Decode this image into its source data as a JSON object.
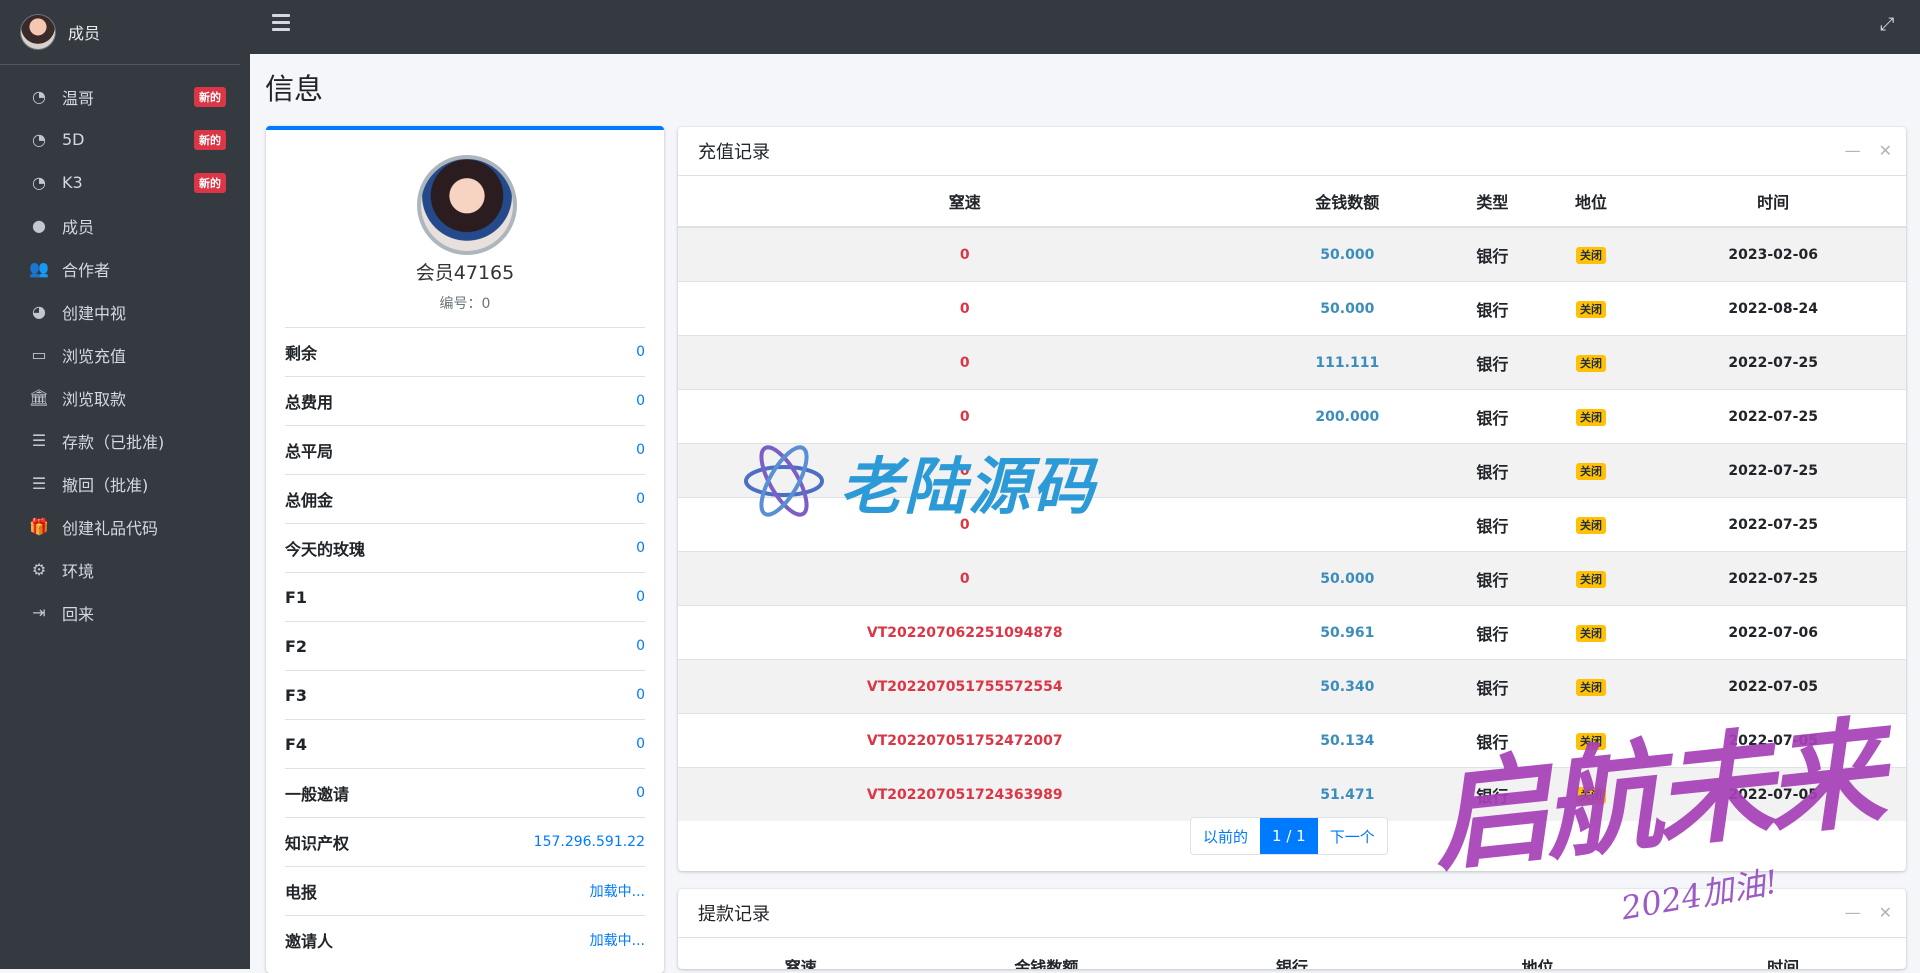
{
  "sidebar": {
    "user_name": "成员",
    "items": [
      {
        "label": "温哥",
        "icon": "tachometer-icon",
        "badge": "新的"
      },
      {
        "label": "5D",
        "icon": "tachometer-icon",
        "badge": "新的"
      },
      {
        "label": "K3",
        "icon": "tachometer-icon",
        "badge": "新的"
      },
      {
        "label": "成员",
        "icon": "user-circle-icon",
        "badge": ""
      },
      {
        "label": "合作者",
        "icon": "users-icon",
        "badge": ""
      },
      {
        "label": "创建中视",
        "icon": "pie-chart-icon",
        "badge": ""
      },
      {
        "label": "浏览充值",
        "icon": "credit-card-icon",
        "badge": ""
      },
      {
        "label": "浏览取款",
        "icon": "bank-icon",
        "badge": ""
      },
      {
        "label": "存款（已批准)",
        "icon": "list-icon",
        "badge": ""
      },
      {
        "label": "撤回（批准)",
        "icon": "list-icon",
        "badge": ""
      },
      {
        "label": "创建礼品代码",
        "icon": "gift-icon",
        "badge": ""
      },
      {
        "label": "环境",
        "icon": "gear-icon",
        "badge": ""
      },
      {
        "label": "回来",
        "icon": "sign-out-icon",
        "badge": ""
      }
    ]
  },
  "page": {
    "title": "信息"
  },
  "profile": {
    "name": "会员47165",
    "id_text": "编号：0",
    "stats": [
      {
        "label": "剩余",
        "value": "0"
      },
      {
        "label": "总费用",
        "value": "0"
      },
      {
        "label": "总平局",
        "value": "0"
      },
      {
        "label": "总佣金",
        "value": "0"
      },
      {
        "label": "今天的玫瑰",
        "value": "0"
      },
      {
        "label": "F1",
        "value": "0"
      },
      {
        "label": "F2",
        "value": "0"
      },
      {
        "label": "F3",
        "value": "0"
      },
      {
        "label": "F4",
        "value": "0"
      },
      {
        "label": "一般邀请",
        "value": "0"
      },
      {
        "label": "知识产权",
        "value": "157.296.591.22"
      },
      {
        "label": "电报",
        "value": "加载中..."
      },
      {
        "label": "邀请人",
        "value": "加载中..."
      }
    ]
  },
  "recharge": {
    "title": "充值记录",
    "columns": [
      "窒速",
      "金钱数额",
      "类型",
      "地位",
      "时间"
    ],
    "rows": [
      {
        "speed": "0",
        "amount": "50.000",
        "type": "银行",
        "status": "关闭",
        "time": "2023-02-06"
      },
      {
        "speed": "0",
        "amount": "50.000",
        "type": "银行",
        "status": "关闭",
        "time": "2022-08-24"
      },
      {
        "speed": "0",
        "amount": "111.111",
        "type": "银行",
        "status": "关闭",
        "time": "2022-07-25"
      },
      {
        "speed": "0",
        "amount": "200.000",
        "type": "银行",
        "status": "关闭",
        "time": "2022-07-25"
      },
      {
        "speed": "0",
        "amount": "",
        "type": "银行",
        "status": "关闭",
        "time": "2022-07-25"
      },
      {
        "speed": "0",
        "amount": "",
        "type": "银行",
        "status": "关闭",
        "time": "2022-07-25"
      },
      {
        "speed": "0",
        "amount": "50.000",
        "type": "银行",
        "status": "关闭",
        "time": "2022-07-25"
      },
      {
        "speed": "VT202207062251094878",
        "amount": "50.961",
        "type": "银行",
        "status": "关闭",
        "time": "2022-07-06"
      },
      {
        "speed": "VT202207051755572554",
        "amount": "50.340",
        "type": "银行",
        "status": "关闭",
        "time": "2022-07-05"
      },
      {
        "speed": "VT202207051752472007",
        "amount": "50.134",
        "type": "银行",
        "status": "关闭",
        "time": "2022-07-05"
      },
      {
        "speed": "VT202207051724363989",
        "amount": "51.471",
        "type": "银行",
        "status": "关闭",
        "time": "2022-07-05"
      }
    ],
    "pagination": {
      "prev": "以前的",
      "current": "1 / 1",
      "next": "下一个"
    }
  },
  "withdraw": {
    "title": "提款记录",
    "columns": [
      "窒速",
      "金钱数额",
      "银行",
      "地位",
      "时间"
    ]
  },
  "watermarks": {
    "text1": "老陆源码",
    "text2": "启航未来",
    "text3": "2024加油!"
  }
}
